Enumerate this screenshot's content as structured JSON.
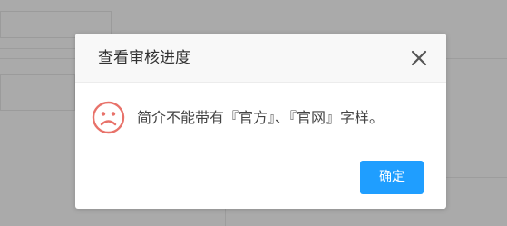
{
  "dialog": {
    "title": "查看审核进度",
    "message": "简介不能带有『官方』、『官网』字样。",
    "confirm_label": "确定",
    "close_icon": "close-icon",
    "status_icon": "sad-face-icon"
  },
  "colors": {
    "accent": "#1f9eff",
    "error": "#e8726a",
    "overlay": "#aaaaaa"
  }
}
